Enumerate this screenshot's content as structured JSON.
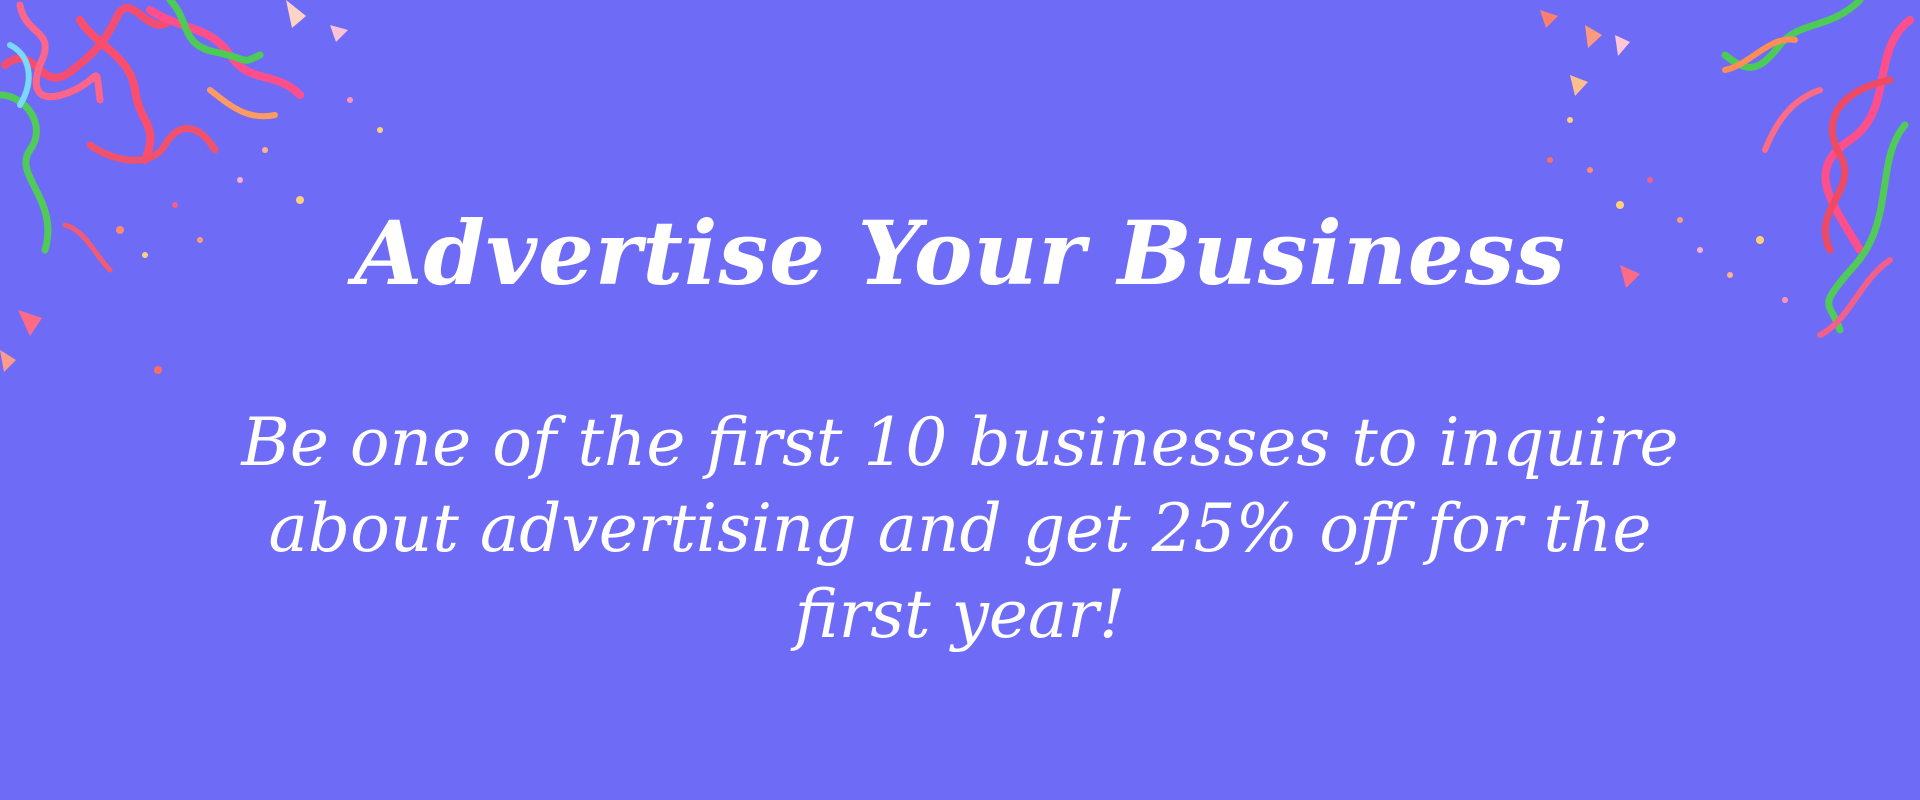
{
  "banner": {
    "headline": "Advertise Your Business",
    "subtext": "Be one of the first 10 businesses to inquire about advertising and get 25% off for the first year!",
    "background_color": "#6e6cf7",
    "text_color": "#ffffff",
    "decor": {
      "left": "confetti-streamers-graphic",
      "right": "confetti-streamers-graphic",
      "colors": [
        "#ff4f8b",
        "#f04a63",
        "#ff9a62",
        "#4ccc57",
        "#7ad7ff",
        "#ffc1d8",
        "#ffd07a"
      ]
    }
  }
}
